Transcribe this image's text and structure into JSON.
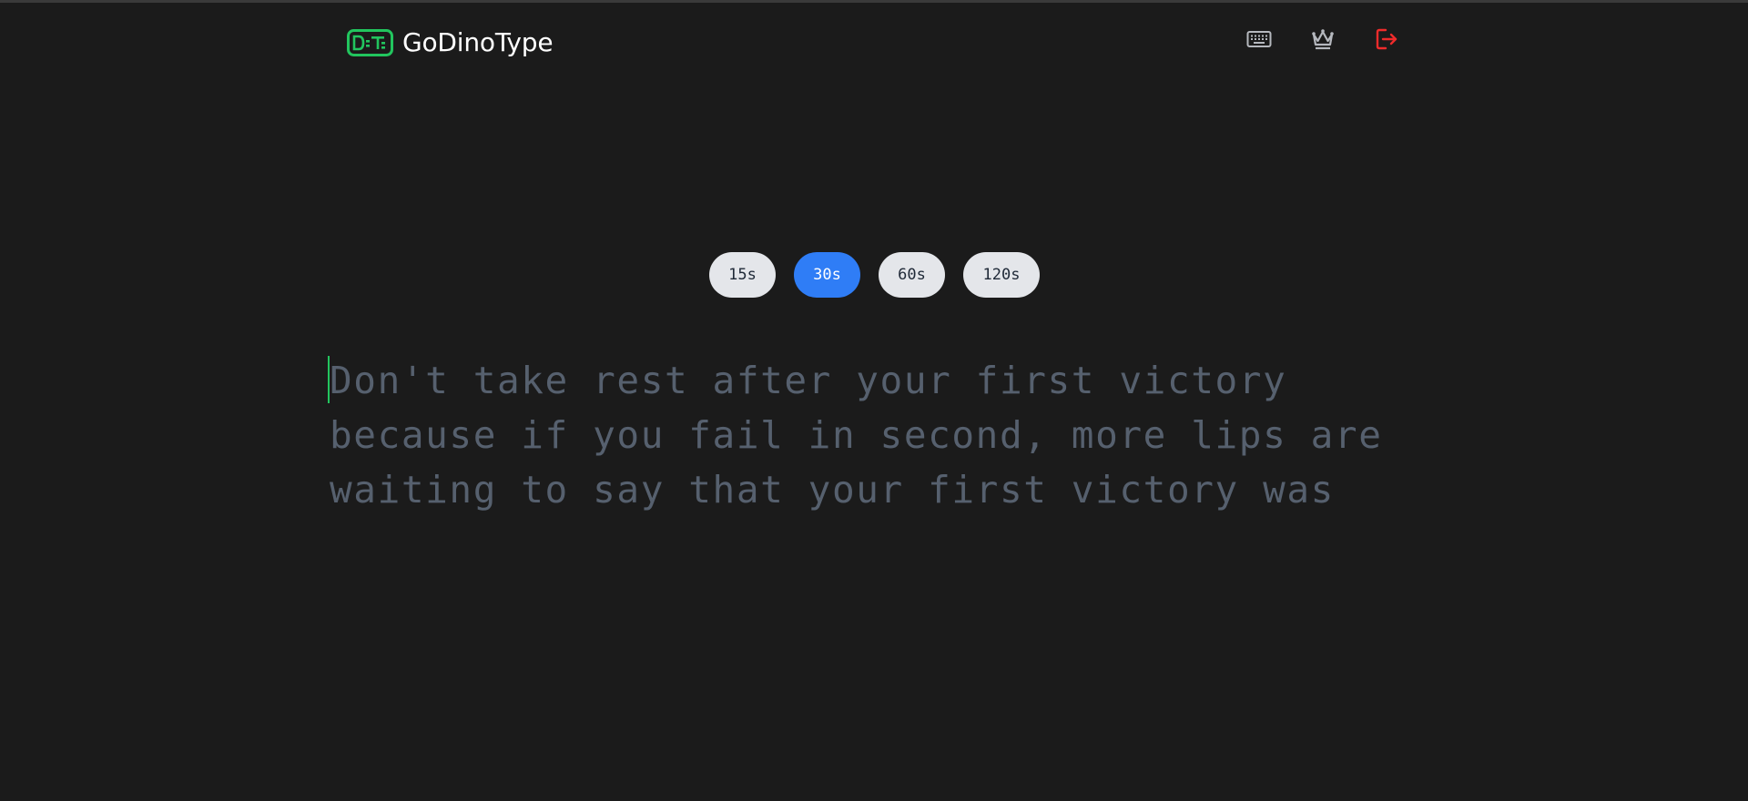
{
  "app": {
    "name": "GoDinoType"
  },
  "nav": {
    "icons": [
      "keyboard-icon",
      "crown-icon",
      "logout-icon"
    ],
    "logout_color": "#ef2b2b"
  },
  "modes": {
    "options": [
      "15s",
      "30s",
      "60s",
      "120s"
    ],
    "selected": "30s"
  },
  "typing": {
    "lines": [
      "Don't take rest after your first victory",
      "because if you fail in second, more lips are",
      "waiting to say that your first victory was"
    ]
  },
  "colors": {
    "background": "#1b1b1b",
    "accent_green": "#22c55e",
    "selected_blue": "#2f7df6",
    "text_muted": "#56606e"
  }
}
